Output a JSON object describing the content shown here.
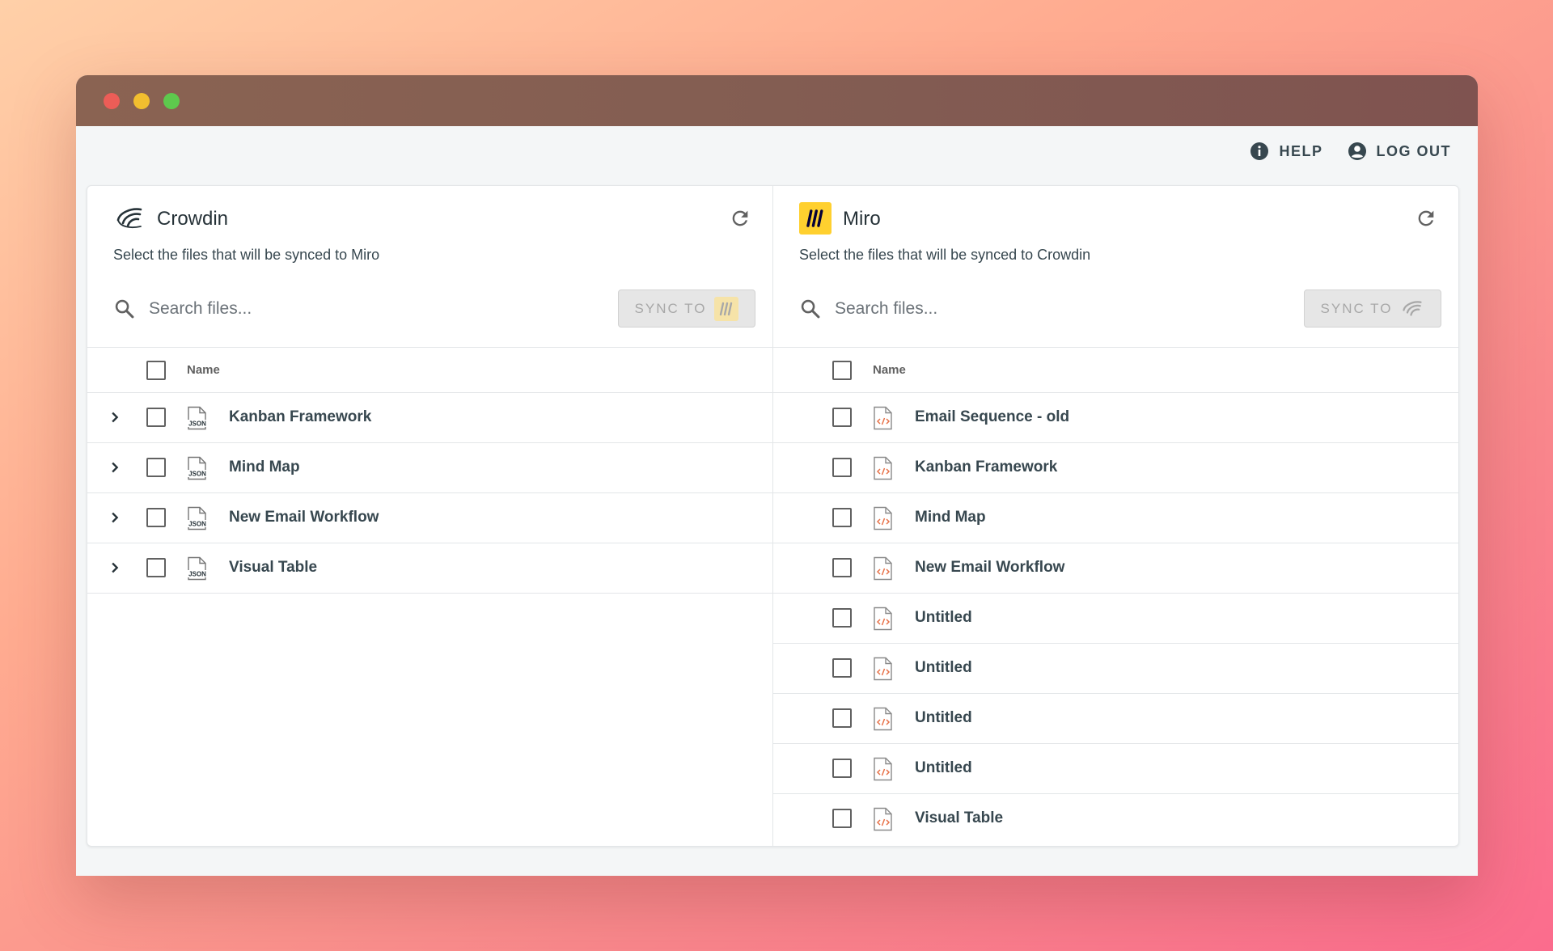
{
  "header": {
    "help_label": "HELP",
    "logout_label": "LOG OUT"
  },
  "crowdin": {
    "title": "Crowdin",
    "subtitle": "Select the files that will be synced to Miro",
    "search_placeholder": "Search files...",
    "sync_label": "SYNC TO",
    "column_name": "Name",
    "files": [
      "Kanban Framework",
      "Mind Map",
      "New Email Workflow",
      "Visual Table"
    ]
  },
  "miro": {
    "title": "Miro",
    "subtitle": "Select the files that will be synced to Crowdin",
    "search_placeholder": "Search files...",
    "sync_label": "SYNC TO",
    "column_name": "Name",
    "files": [
      "Email Sequence - old",
      "Kanban Framework",
      "Mind Map",
      "New Email Workflow",
      "Untitled",
      "Untitled",
      "Untitled",
      "Untitled",
      "Visual Table"
    ]
  },
  "colors": {
    "miro_yellow": "#ffd02f",
    "file_icon_accent": "#e8734a"
  }
}
